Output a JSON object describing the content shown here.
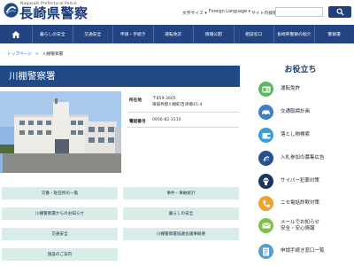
{
  "header": {
    "logo_en": "Nagasaki Prefectural Police",
    "logo_ja": "長崎県警察",
    "font_size_label": "文字サイズ",
    "language_label": "Foreign Language",
    "site_search_label": "サイト内検索",
    "search_placeholder": ""
  },
  "nav": {
    "items": [
      "暮らしの安全",
      "交通安全",
      "申請・手続き",
      "運転免許",
      "情報公開",
      "相談窓口",
      "長崎県警察の紹介",
      "警察署"
    ]
  },
  "breadcrumb": {
    "home": "トップページ",
    "separator": ">",
    "current": "川棚警察署"
  },
  "page": {
    "title": "川棚警察署"
  },
  "info": {
    "location_label": "所在地",
    "postal": "〒859-3605",
    "address": "東彼杵郡川棚町百津郷41-4",
    "phone_label": "電話番号",
    "phone": "0956-82-3110"
  },
  "links": [
    "交番・駐在所の一覧",
    "事件・事故統計",
    "川棚警察署からのお知らせ",
    "暮らしの安全",
    "交通安全",
    "川棚警察署協議会議事概要",
    "施設のご案内"
  ],
  "sidebar": {
    "title": "お役立ち",
    "items": [
      {
        "label": "運転免許",
        "icon": "license-card-icon",
        "color": "#5cb85c"
      },
      {
        "label": "交通取締計画",
        "icon": "police-car-icon",
        "color": "#3f7fc7"
      },
      {
        "label": "落とし物検索",
        "icon": "wallet-icon",
        "color": "#3a9fd8"
      },
      {
        "label": "入札参加の募集広告",
        "icon": "police-logo-icon",
        "color": "#2a4f8f"
      },
      {
        "label": "サイバー犯罪対策",
        "icon": "cyber-crime-icon",
        "color": "#1d3563"
      },
      {
        "label": "ニセ電話詐欺対策",
        "icon": "phone-scam-icon",
        "color": "#f0a030"
      },
      {
        "label": "メールでお知らせ\n安全・安心情報",
        "icon": "mail-icon",
        "color": "#7cc24a"
      },
      {
        "label": "申請手続き窓口一覧",
        "icon": "application-window-icon",
        "color": "#5a9ec8"
      }
    ]
  }
}
